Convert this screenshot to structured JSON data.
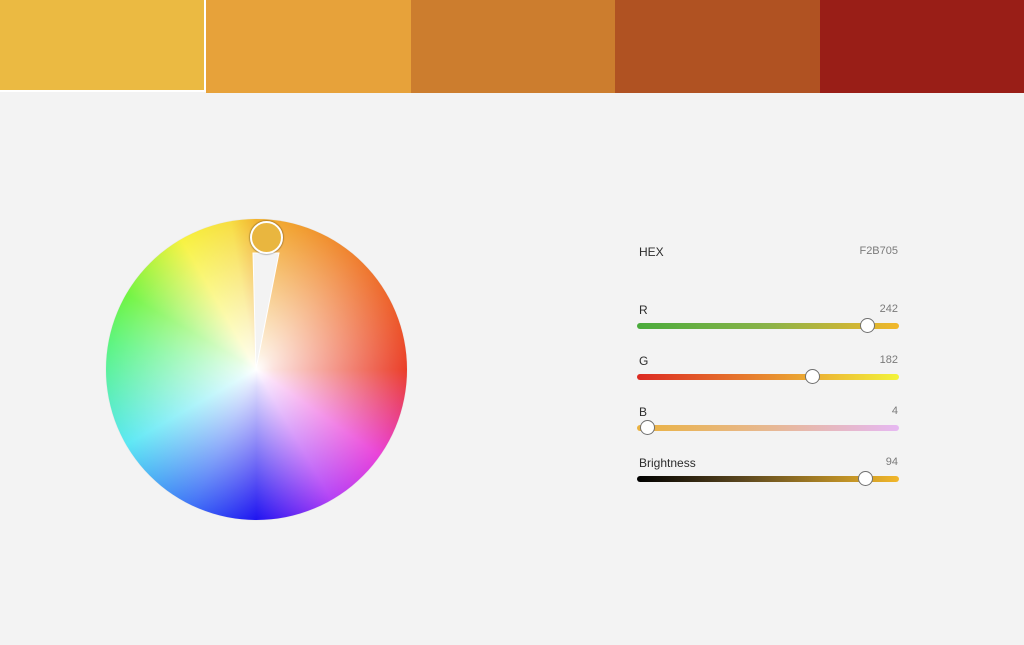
{
  "swatches": [
    {
      "color": "#ebba42",
      "selected": true
    },
    {
      "color": "#e7a23a"
    },
    {
      "color": "#cc7d2e"
    },
    {
      "color": "#b05222"
    },
    {
      "color": "#991e17"
    }
  ],
  "wheel": {
    "handle_color": "#e9b63f"
  },
  "hex": {
    "label": "HEX",
    "value": "F2B705"
  },
  "sliders": [
    {
      "id": "r",
      "label": "R",
      "value": "242",
      "fraction": 0.949,
      "gradient": "linear-gradient(to right, #4aab3c 0%, #8ab348 50%, #f2b72a 100%)"
    },
    {
      "id": "g",
      "label": "G",
      "value": "182",
      "fraction": 0.714,
      "gradient": "linear-gradient(to right, #dc2a22 0%, #e88a2f 50%, #f2f43b 100%)"
    },
    {
      "id": "b",
      "label": "B",
      "value": "4",
      "fraction": 0.016,
      "gradient": "linear-gradient(to right, #eab240 0%, #e7b891 50%, #e6b8f2 100%)"
    },
    {
      "id": "brightness",
      "label": "Brightness",
      "value": "94",
      "fraction": 0.94,
      "gradient": "linear-gradient(to right, #000000 0%, #5a461e 40%, #f2b72a 100%)"
    }
  ]
}
